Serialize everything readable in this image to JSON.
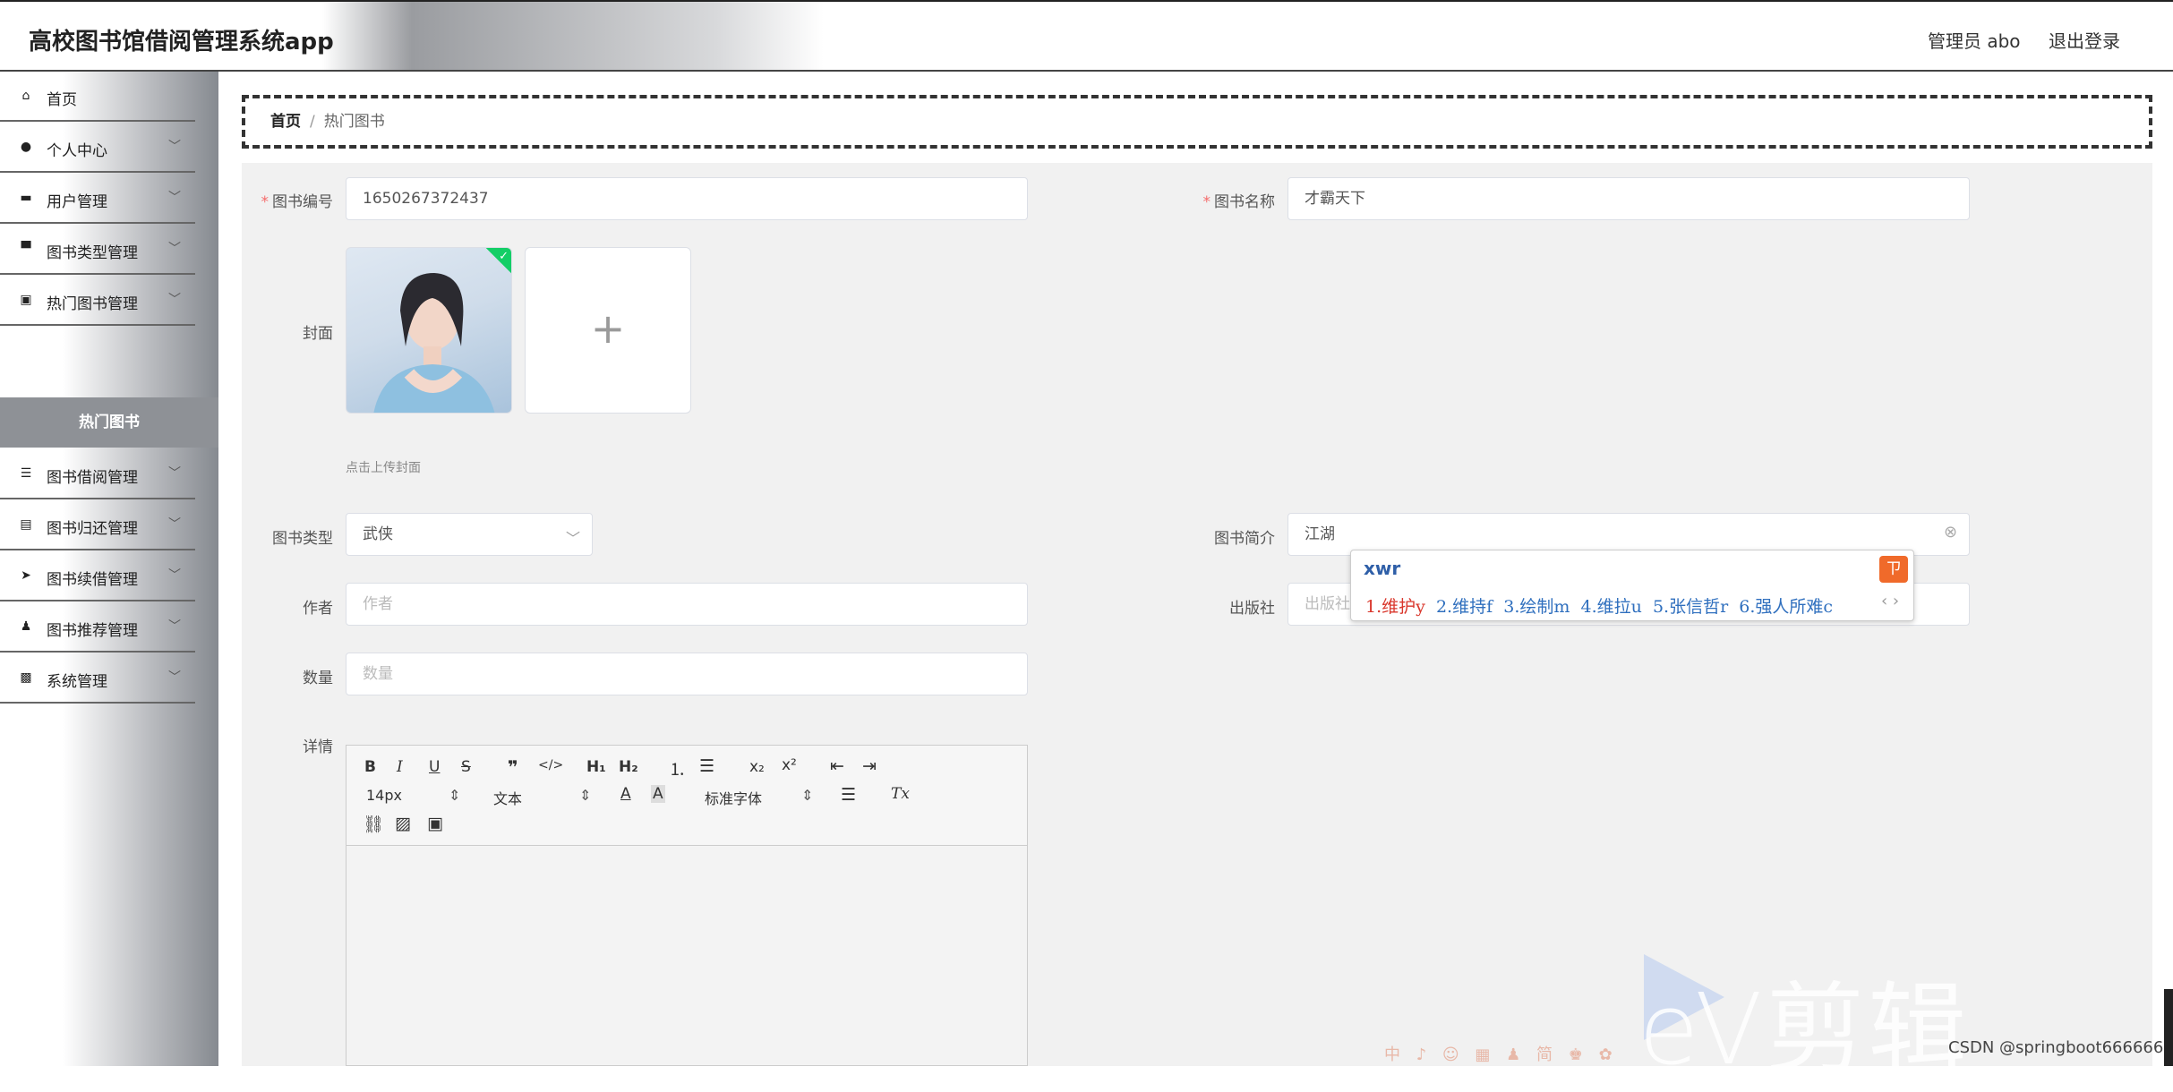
{
  "header": {
    "title": "高校图书馆借阅管理系统app",
    "admin": "管理员 abo",
    "logout": "退出登录"
  },
  "sidebar": {
    "items": [
      {
        "label": "首页",
        "icon": "home-icon",
        "glyph": "⌂",
        "chevron": false
      },
      {
        "label": "个人中心",
        "icon": "user-icon",
        "glyph": "●",
        "chevron": true
      },
      {
        "label": "用户管理",
        "icon": "briefcase-icon",
        "glyph": "▬",
        "chevron": true
      },
      {
        "label": "图书类型管理",
        "icon": "monitor-icon",
        "glyph": "▀",
        "chevron": true
      },
      {
        "label": "热门图书管理",
        "icon": "clipboard-icon",
        "glyph": "▣",
        "chevron": true
      },
      {
        "label": "图书借阅管理",
        "icon": "sliders-icon",
        "glyph": "☰",
        "chevron": true
      },
      {
        "label": "图书归还管理",
        "icon": "notebook-icon",
        "glyph": "▤",
        "chevron": true
      },
      {
        "label": "图书续借管理",
        "icon": "send-icon",
        "glyph": "➤",
        "chevron": true
      },
      {
        "label": "图书推荐管理",
        "icon": "stamp-icon",
        "glyph": "♟",
        "chevron": true
      },
      {
        "label": "系统管理",
        "icon": "settings-box-icon",
        "glyph": "▩",
        "chevron": true
      }
    ],
    "active_sub": "热门图书"
  },
  "breadcrumb": {
    "home": "首页",
    "separator": "/",
    "current": "热门图书"
  },
  "form": {
    "book_no": {
      "label": "图书编号",
      "value": "1650267372437",
      "required": true
    },
    "book_name": {
      "label": "图书名称",
      "value": "才霸天下",
      "required": true
    },
    "cover": {
      "label": "封面",
      "hint": "点击上传封面",
      "upload_glyph": "+"
    },
    "book_type": {
      "label": "图书类型",
      "value": "武侠"
    },
    "intro": {
      "label": "图书简介",
      "value": "江湖"
    },
    "author": {
      "label": "作者",
      "placeholder": "作者"
    },
    "publisher": {
      "label": "出版社",
      "placeholder": "出版社"
    },
    "quantity": {
      "label": "数量",
      "placeholder": "数量"
    },
    "details": {
      "label": "详情"
    }
  },
  "editor": {
    "font_size": "14px",
    "text_style": "文本",
    "font_family": "标准字体"
  },
  "ime": {
    "typed": "xwr",
    "candidates": [
      "1.维护y",
      "2.维持f",
      "3.绘制m",
      "4.维拉u",
      "5.张信哲r",
      "6.强人所难c"
    ],
    "logo": "ㄗ"
  },
  "overlay": {
    "watermark": "eV剪辑",
    "credit": "CSDN @springboot666666",
    "tray": "中 ♪ ☺ ▦ ♟ 简 ♚ ✿"
  }
}
